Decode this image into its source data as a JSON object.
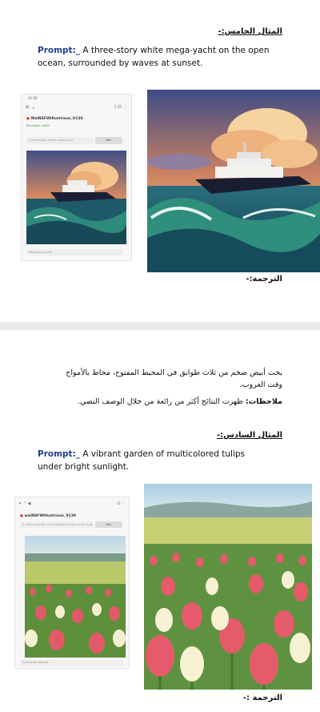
{
  "example5": {
    "heading": "المثال الخامس:-",
    "prompt_label": "Prompt:_",
    "prompt_text": " A three-story white mega-yacht on the open ocean, surrounded by waves at sunset.",
    "phone": {
      "time": "21:56",
      "model_name": "WaiNSFWIllustrious_V130",
      "status": "Running in 4000",
      "field_placeholder": "A three-story white mega-yacht",
      "button": "Run",
      "footer_field": "Negative prompt"
    },
    "translation_label": "الترجمة:-"
  },
  "example5_notes": {
    "translation": "يخت أبيض ضخم من ثلاث طوابق في المحيط المفتوح، محاط بالأمواج وقت الغروب.",
    "notes_label": "ملاحظات:",
    "notes_text": " ظهرت النتائج أكثر من رائعة من خلال الوصف النصي."
  },
  "example6": {
    "heading": "المثال السادس:-",
    "prompt_label": "Prompt:_",
    "prompt_text": " A vibrant garden of multicolored tulips under bright sunlight.",
    "phone": {
      "model_name": "waiNSFWIllustrious_V130",
      "field_text": "A vibrant garden of multicolored tulips under bright sunlight",
      "button": "Run",
      "footer_field": "Advanced Settings"
    },
    "translation_label": "الترجمة :-"
  },
  "colors": {
    "prompt_label": "#1f3f8f",
    "divider": "#e9e9e9"
  }
}
